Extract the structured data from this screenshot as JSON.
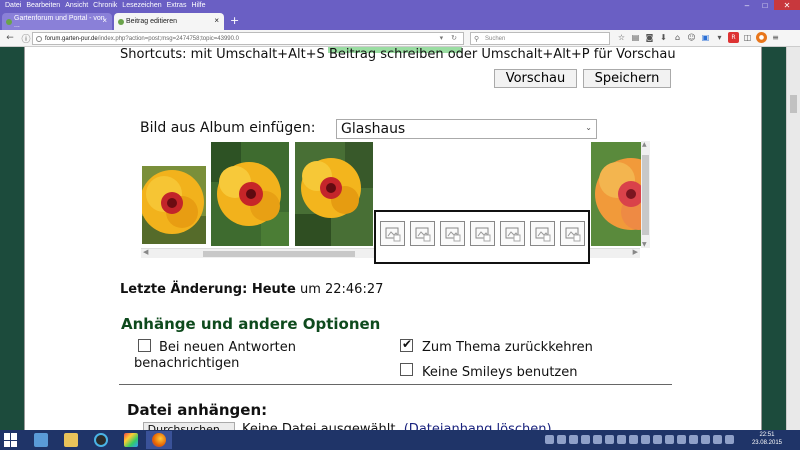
{
  "menu": [
    "Datei",
    "Bearbeiten",
    "Ansicht",
    "Chronik",
    "Lesezeichen",
    "Extras",
    "Hilfe"
  ],
  "tabs": [
    {
      "label": "Gartenforum und Portal - von ..."
    },
    {
      "label": "Beitrag editieren"
    }
  ],
  "nav": {
    "url_domain": "forum.garten-pur.de",
    "url_path": "/index.php?action=post;msg=2474758;topic=43990.0",
    "search_placeholder": "Suchen"
  },
  "editor": {
    "shortcuts": "Shortcuts: mit Umschalt+Alt+S Beitrag schreiben oder Umschalt+Alt+P für Vorschau",
    "preview_label": "Vorschau",
    "save_label": "Speichern"
  },
  "album": {
    "label": "Bild aus Album einfügen:",
    "selected": "Glashaus",
    "images": [
      {
        "name": "hibiscus-photo-1"
      },
      {
        "name": "hibiscus-photo-2"
      },
      {
        "name": "hibiscus-photo-3"
      },
      {
        "name": "hibiscus-photo-4"
      }
    ],
    "broken_placeholders": 7
  },
  "last_change": {
    "label": "Letzte Änderung: Heute",
    "time": "um 22:46:27"
  },
  "options": {
    "title": "Anhänge und andere Optionen",
    "notify": {
      "label": "Bei neuen Antworten benachrichtigen",
      "checked": false
    },
    "return_to_topic": {
      "label": "Zum Thema zurückkehren",
      "checked": true
    },
    "no_smileys": {
      "label": "Keine Smileys benutzen",
      "checked": false
    }
  },
  "attach": {
    "title": "Datei anhängen:",
    "browse_label": "Durchsuchen...",
    "status": "Keine Datei ausgewählt.",
    "clear_link": "(Dateianhang löschen)"
  },
  "taskbar": {
    "time": "22:51",
    "date": "23.08.2015"
  },
  "colors": {
    "firefox_chrome": "#6a5fc4",
    "forum_green": "#1c4b3c",
    "section_title": "#0e4a1d",
    "taskbar": "#1f3468"
  }
}
